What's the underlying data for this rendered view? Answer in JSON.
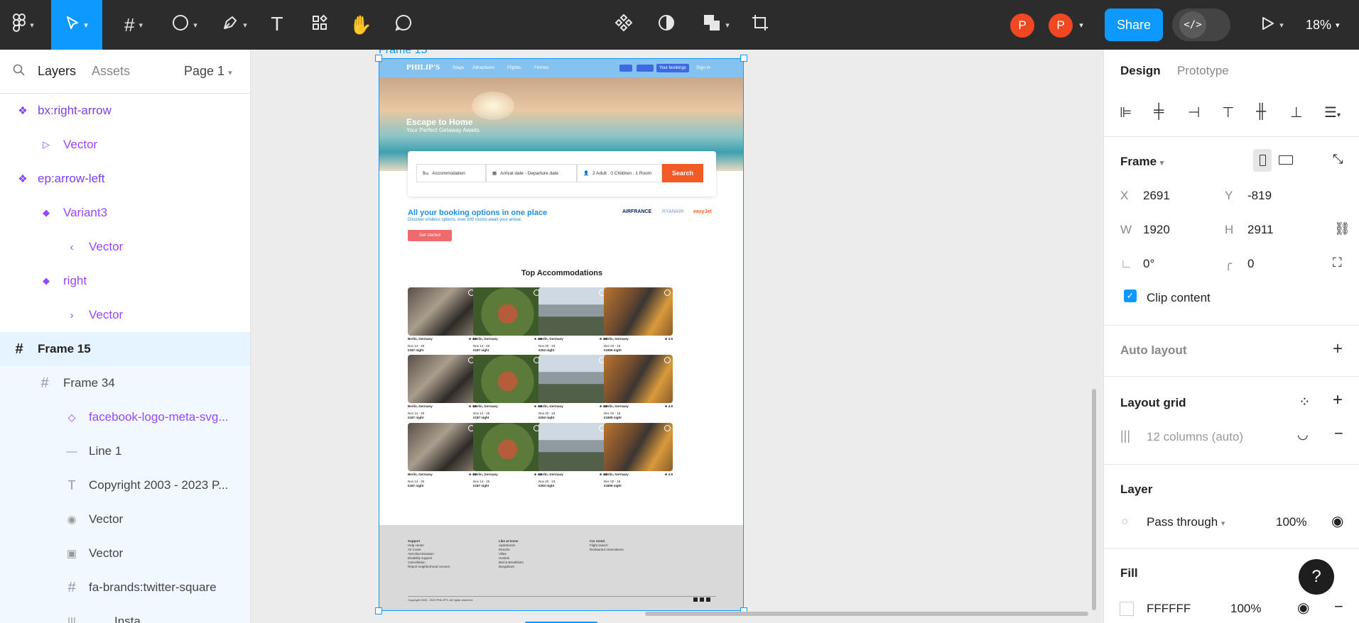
{
  "toolbar": {
    "main_menu_icon": "figma-logo-icon",
    "move_tool_icon": "pointer-icon",
    "frame_tool_icon": "frame-hash-icon",
    "shape_tool_icon": "ellipse-icon",
    "pen_tool_icon": "pen-icon",
    "text_tool_icon": "text-T-icon",
    "resources_icon": "resources-icon",
    "hand_tool_icon": "hand-icon",
    "comment_tool_icon": "comment-icon",
    "component_icon": "component-icon",
    "mask_icon": "contrast-icon",
    "boolean_icon": "boolean-union-icon",
    "crop_icon": "crop-icon",
    "avatar1": "P",
    "avatar2": "P",
    "share_label": "Share",
    "dev_mode_icon": "code-icon",
    "play_icon": "play-icon",
    "zoom": "18%",
    "accent_color": "#0d99ff",
    "avatar_color": "#f24822"
  },
  "left_panel": {
    "tab_layers": "Layers",
    "tab_assets": "Assets",
    "page": "Page 1",
    "layers": [
      {
        "label": "bx:right-arrow",
        "icon": "component-icon"
      },
      {
        "label": "Vector",
        "icon": "play-outline-icon"
      },
      {
        "label": "ep:arrow-left",
        "icon": "component-icon"
      },
      {
        "label": "Variant3",
        "icon": "diamond-icon"
      },
      {
        "label": "Vector",
        "icon": "chevron-left-icon"
      },
      {
        "label": "right",
        "icon": "diamond-icon"
      },
      {
        "label": "Vector",
        "icon": "chevron-right-icon"
      },
      {
        "label": "Frame 15",
        "icon": "frame-hash-icon"
      },
      {
        "label": "Frame 34",
        "icon": "frame-hash-icon"
      },
      {
        "label": "facebook-logo-meta-svg...",
        "icon": "diamond-outline-icon"
      },
      {
        "label": "Line 1",
        "icon": "line-icon"
      },
      {
        "label": "Copyright 2003 - 2023 P...",
        "icon": "text-T-icon"
      },
      {
        "label": "Vector",
        "icon": "target-icon"
      },
      {
        "label": "Vector",
        "icon": "image-icon"
      },
      {
        "label": "fa-brands:twitter-square",
        "icon": "frame-hash-icon"
      },
      {
        "label": "Insta",
        "icon": "columns-icon"
      }
    ]
  },
  "canvas": {
    "frame_label": "Frame 15",
    "mockup": {
      "logo": "PHILIP'S",
      "nav_links": [
        "Stays",
        "Attractions",
        "Flights",
        "Ferries"
      ],
      "nav_right": [
        "Your bookings",
        "Sign in"
      ],
      "hero_title": "Escape to Home",
      "hero_subtitle": "Your Perfect Getaway Awaits",
      "search_fields": [
        "Accommodation",
        "Arrival date - Departure date",
        "2 Adult . 0 Children . 1 Room"
      ],
      "search_button": "Search",
      "booking_title": "All your booking options in one place",
      "booking_sub": "Discover endless options, over 800 rooms await your arrival.",
      "get_started": "Get started",
      "brands": [
        "AIRFRANCE",
        "RYANAIR",
        "easyJet"
      ],
      "top_title": "Top Accommodations",
      "cards": [
        {
          "city": "Berlin, Germany",
          "rating": "4.9",
          "dates": "Nov 14 - 20",
          "price": "€187 night"
        },
        {
          "city": "Berlin, Germany",
          "rating": "4.9",
          "dates": "Nov 14 - 25",
          "price": "€187 night"
        },
        {
          "city": "Berlin, Germany",
          "rating": "4.9",
          "dates": "Nov 20 - 23",
          "price": "€253 night"
        },
        {
          "city": "Berlin, Germany",
          "rating": "4.9",
          "dates": "Dec 02 - 15",
          "price": "€1809 night"
        },
        {
          "city": "Berlin, Germany",
          "rating": "4.9",
          "dates": "Nov 14 - 20",
          "price": "€187 night"
        },
        {
          "city": "Berlin, Germany",
          "rating": "4.9",
          "dates": "Nov 14 - 25",
          "price": "€187 night"
        },
        {
          "city": "Berlin, Germany",
          "rating": "4.9",
          "dates": "Nov 20 - 23",
          "price": "€253 night"
        },
        {
          "city": "Berlin, Germany",
          "rating": "4.9",
          "dates": "Dec 02 - 15",
          "price": "€1809 night"
        },
        {
          "city": "Berlin, Germany",
          "rating": "4.9",
          "dates": "Nov 14 - 20",
          "price": "€187 night"
        },
        {
          "city": "Berlin, Germany",
          "rating": "4.9",
          "dates": "Nov 14 - 25",
          "price": "€187 night"
        },
        {
          "city": "Berlin, Germany",
          "rating": "4.9",
          "dates": "Nov 20 - 23",
          "price": "€253 night"
        },
        {
          "city": "Berlin, Germany",
          "rating": "4.9",
          "dates": "Dec 02 - 15",
          "price": "€1809 night"
        }
      ],
      "footer_cols": [
        {
          "title": "Support",
          "items": [
            "Help center",
            "Air Cover",
            "Anti-discrimination",
            "Disability support",
            "Cancellation",
            "Report neighborhood concern"
          ]
        },
        {
          "title": "Like at home",
          "items": [
            "Apartments",
            "Resorts",
            "Villas",
            "Hostels",
            "Bed & Breakfasts",
            "Bungalows"
          ]
        },
        {
          "title": "Car rental",
          "items": [
            "Flight search",
            "Restaurant reservations"
          ]
        }
      ],
      "copyright": "Copyright 2003 - 2023 PHILIP'S. All rights reserved."
    }
  },
  "right_panel": {
    "tab_design": "Design",
    "tab_prototype": "Prototype",
    "frame_title": "Frame",
    "x_label": "X",
    "x": "2691",
    "y_label": "Y",
    "y": "-819",
    "w_label": "W",
    "w": "1920",
    "h_label": "H",
    "h": "2911",
    "rotation": "0°",
    "radius": "0",
    "clip_content": "Clip content",
    "auto_layout": "Auto layout",
    "layout_grid": "Layout grid",
    "grid_value": "12 columns (auto)",
    "layer": "Layer",
    "blend": "Pass through",
    "opacity": "100%",
    "fill": "Fill",
    "fill_hex": "FFFFFF",
    "fill_opacity": "100%"
  },
  "help": "?"
}
